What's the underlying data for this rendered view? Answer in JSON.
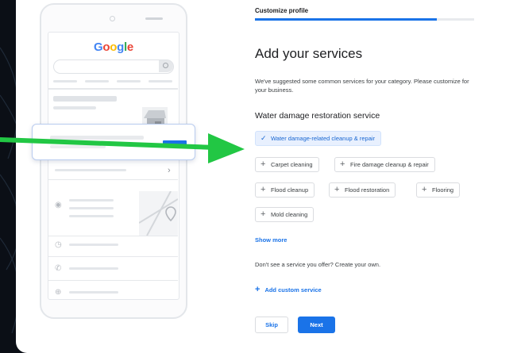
{
  "phone": {
    "logo_letters": [
      {
        "char": "G",
        "color": "#4285f4"
      },
      {
        "char": "o",
        "color": "#ea4335"
      },
      {
        "char": "o",
        "color": "#fbbc05"
      },
      {
        "char": "g",
        "color": "#4285f4"
      },
      {
        "char": "l",
        "color": "#34a853"
      },
      {
        "char": "e",
        "color": "#ea4335"
      }
    ],
    "stars": "★★★★★",
    "chevron": "›",
    "row_icons": [
      "◉",
      "◷",
      "✆",
      "⊕"
    ]
  },
  "header": {
    "breadcrumb": "Customize profile",
    "progress_fraction": 0.83
  },
  "main": {
    "title": "Add your services",
    "description": "We've suggested some common services for your category. Please customize for your business.",
    "section_title": "Water damage restoration service",
    "chips": [
      {
        "label": "Water damage-related cleanup & repair",
        "icon": "✓",
        "selected": true
      },
      {
        "label": "Carpet cleaning",
        "icon": "+",
        "selected": false
      },
      {
        "label": "Fire damage cleanup & repair",
        "icon": "+",
        "selected": false
      },
      {
        "label": "Flood cleanup",
        "icon": "+",
        "selected": false
      },
      {
        "label": "Flood restoration",
        "icon": "+",
        "selected": false
      },
      {
        "label": "Flooring",
        "icon": "+",
        "selected": false
      },
      {
        "label": "Mold cleaning",
        "icon": "+",
        "selected": false
      }
    ],
    "show_more": "Show more",
    "create_own_text": "Don't see a service you offer? Create your own.",
    "add_custom_icon": "+",
    "add_custom_label": "Add custom service",
    "skip_label": "Skip",
    "next_label": "Next"
  },
  "colors": {
    "accent": "#1a73e8",
    "arrow": "#22c744",
    "selected_chip_bg": "#e8f0fe"
  }
}
